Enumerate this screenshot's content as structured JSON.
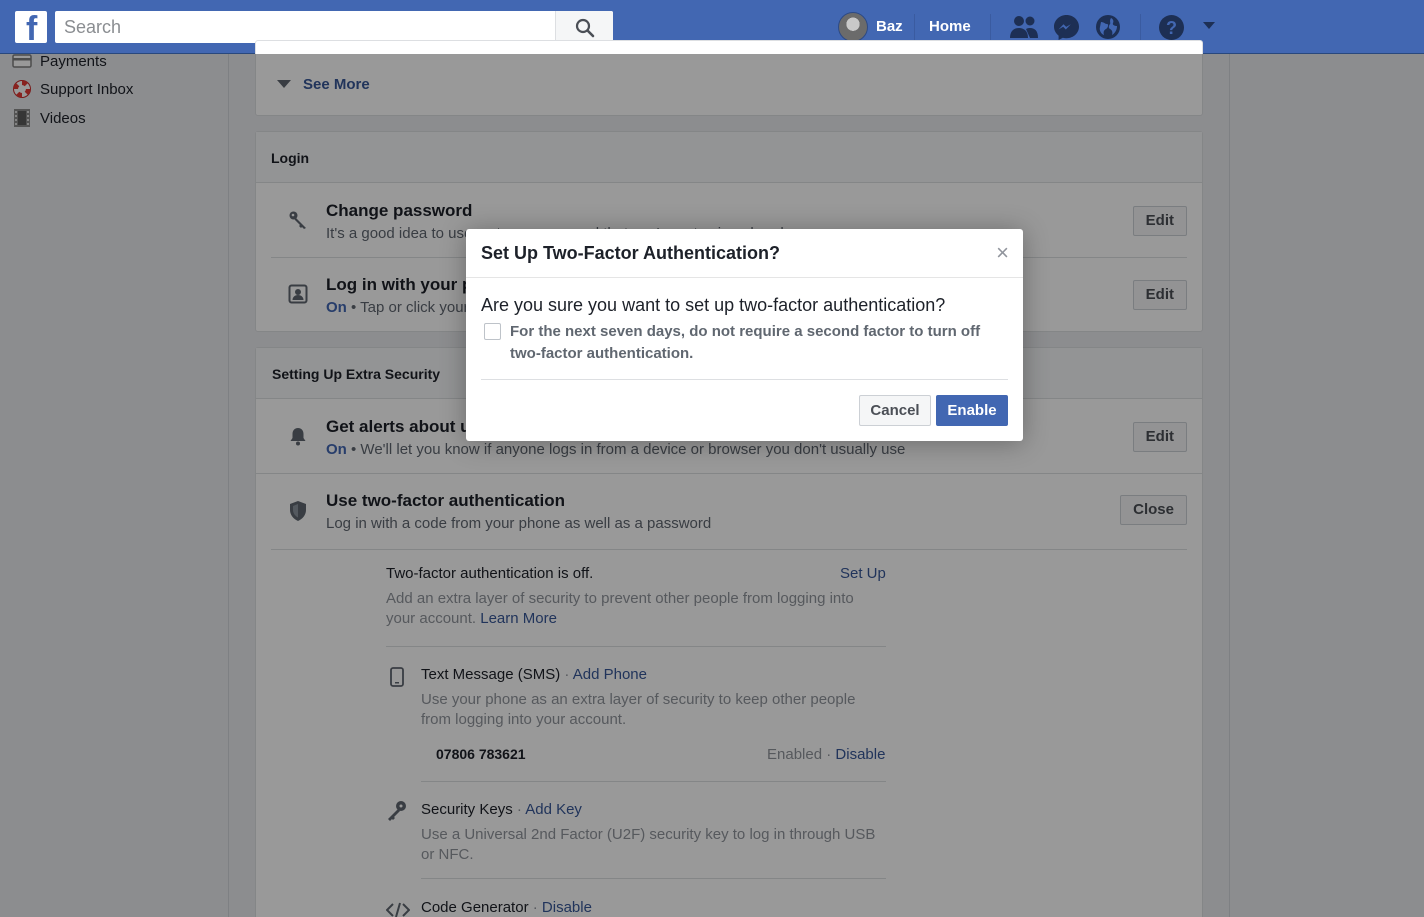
{
  "topbar": {
    "logo_letter": "f",
    "search_placeholder": "Search",
    "user_name": "Baz",
    "home_label": "Home"
  },
  "sidebar": {
    "items": [
      {
        "label": "Payments",
        "icon": "credit-card-icon"
      },
      {
        "label": "Support Inbox",
        "icon": "lifebuoy-icon"
      },
      {
        "label": "Videos",
        "icon": "film-icon"
      }
    ]
  },
  "see_more": {
    "label": "See More"
  },
  "login_section": {
    "title": "Login",
    "rows": [
      {
        "title": "Change password",
        "sub": "It's a good idea to use a strong password that you're not using elsewhere",
        "button": "Edit"
      },
      {
        "title": "Log in with your profile picture",
        "status": "On",
        "sub": " • Tap or click your profile picture to log in, instead of using a password",
        "button": "Edit"
      }
    ]
  },
  "extra_security": {
    "title": "Setting Up Extra Security",
    "alerts": {
      "title": "Get alerts about unrecognised logins",
      "status": "On",
      "sub": " • We'll let you know if anyone logs in from a device or browser you don't usually use",
      "button": "Edit"
    },
    "two_factor": {
      "title": "Use two-factor authentication",
      "sub": "Log in with a code from your phone as well as a password",
      "button": "Close"
    }
  },
  "two_factor_details": {
    "status": "Two-factor authentication is off.",
    "setup_link": "Set Up",
    "desc": "Add an extra layer of security to prevent other people from logging into",
    "desc2": "your account.",
    "learn_more": "Learn More",
    "sms": {
      "title": "Text Message (SMS)",
      "sep": " · ",
      "action": "Add Phone",
      "desc1": "Use your phone as an extra layer of security to keep other people",
      "desc2": "from logging into your account.",
      "phone": "07806 783621",
      "state": "Enabled",
      "disable": "Disable"
    },
    "keys": {
      "title": "Security Keys",
      "action": "Add Key",
      "desc1": "Use a Universal 2nd Factor (U2F) security key to log in through USB",
      "desc2": "or NFC."
    },
    "codegen": {
      "title": "Code Generator",
      "action": "Disable"
    }
  },
  "dialog": {
    "title": "Set Up Two-Factor Authentication?",
    "close": "×",
    "question": "Are you sure you want to set up two-factor authentication?",
    "checkbox_label": "For the next seven days, do not require a second factor to turn off two-factor authentication.",
    "cancel": "Cancel",
    "enable": "Enable"
  }
}
